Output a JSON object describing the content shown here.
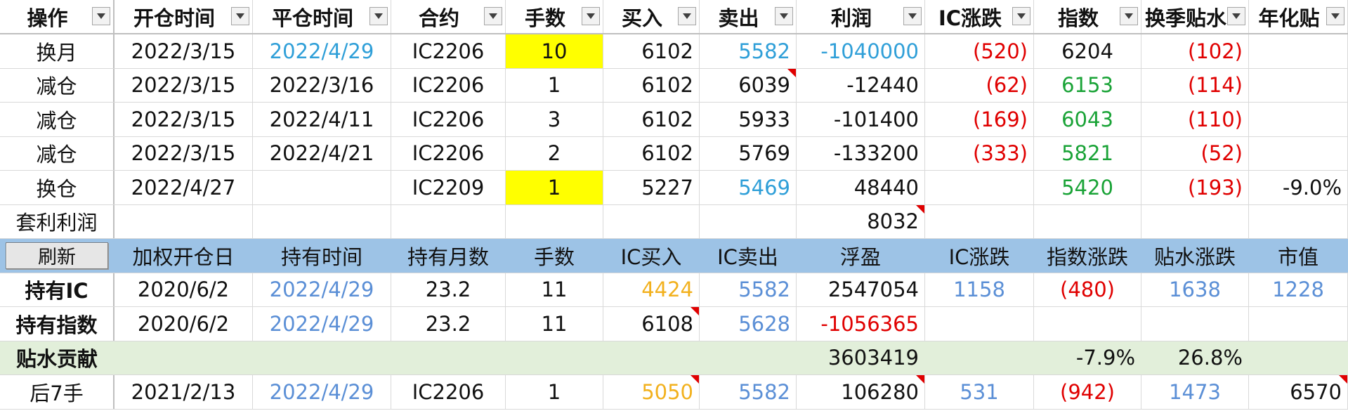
{
  "header": [
    "操作",
    "开仓时间",
    "平仓时间",
    "合约",
    "手数",
    "买入",
    "卖出",
    "利润",
    "IC涨跌",
    "指数",
    "换季贴水",
    "年化贴"
  ],
  "trades": [
    {
      "op": "换月",
      "open": "2022/3/15",
      "close": "2022/4/29",
      "contract": "IC2206",
      "qty": "10",
      "buy": "6102",
      "sell": "5582",
      "profit": "-1040000",
      "ic_change": "(520)",
      "index": "6204",
      "swap_discount": "(102)",
      "annual": ""
    },
    {
      "op": "减仓",
      "open": "2022/3/15",
      "close": "2022/3/16",
      "contract": "IC2206",
      "qty": "1",
      "buy": "6102",
      "sell": "6039",
      "profit": "-12440",
      "ic_change": "(62)",
      "index": "6153",
      "swap_discount": "(114)",
      "annual": ""
    },
    {
      "op": "减仓",
      "open": "2022/3/15",
      "close": "2022/4/11",
      "contract": "IC2206",
      "qty": "3",
      "buy": "6102",
      "sell": "5933",
      "profit": "-101400",
      "ic_change": "(169)",
      "index": "6043",
      "swap_discount": "(110)",
      "annual": ""
    },
    {
      "op": "减仓",
      "open": "2022/3/15",
      "close": "2022/4/21",
      "contract": "IC2206",
      "qty": "2",
      "buy": "6102",
      "sell": "5769",
      "profit": "-133200",
      "ic_change": "(333)",
      "index": "5821",
      "swap_discount": "(52)",
      "annual": ""
    },
    {
      "op": "换仓",
      "open": "2022/4/27",
      "close": "",
      "contract": "IC2209",
      "qty": "1",
      "buy": "5227",
      "sell": "5469",
      "profit": "48440",
      "ic_change": "",
      "index": "5420",
      "swap_discount": "(193)",
      "annual": "-9.0%"
    }
  ],
  "arbitrage": {
    "label": "套利利润",
    "profit": "8032"
  },
  "refresh_label": "刷新",
  "holdings_header": [
    "加权开仓日",
    "持有时间",
    "持有月数",
    "手数",
    "IC买入",
    "IC卖出",
    "浮盈",
    "IC涨跌",
    "指数涨跌",
    "贴水涨跌",
    "市值"
  ],
  "holdings": [
    {
      "label": "持有IC",
      "open": "2020/6/2",
      "hold": "2022/4/29",
      "months": "23.2",
      "qty": "11",
      "buy": "4424",
      "sell": "5582",
      "pnl": "2547054",
      "ic_change": "1158",
      "index_change": "(480)",
      "discount_change": "1638",
      "value": "1228"
    },
    {
      "label": "持有指数",
      "open": "2020/6/2",
      "hold": "2022/4/29",
      "months": "23.2",
      "qty": "11",
      "buy": "6108",
      "sell": "5628",
      "pnl": "-1056365",
      "ic_change": "",
      "index_change": "",
      "discount_change": "",
      "value": ""
    }
  ],
  "contribution": {
    "label": "贴水贡献",
    "value": "3603419",
    "index_pct": "-7.9%",
    "discount_pct": "26.8%"
  },
  "last_row": {
    "label": "后7手",
    "open": "2021/2/13",
    "close": "2022/4/29",
    "contract": "IC2206",
    "qty": "1",
    "buy": "5050",
    "sell": "5582",
    "profit": "106280",
    "ic_change": "531",
    "index": "(942)",
    "discount": "1473",
    "value": "6570"
  },
  "colors": {
    "blue": "#2f9fd8",
    "red": "#e00000",
    "green": "#1aa337",
    "yellow": "#ffff00",
    "header_blue": "#9dc3e6",
    "light_green": "#e2efda",
    "orange": "#f2b11e"
  }
}
